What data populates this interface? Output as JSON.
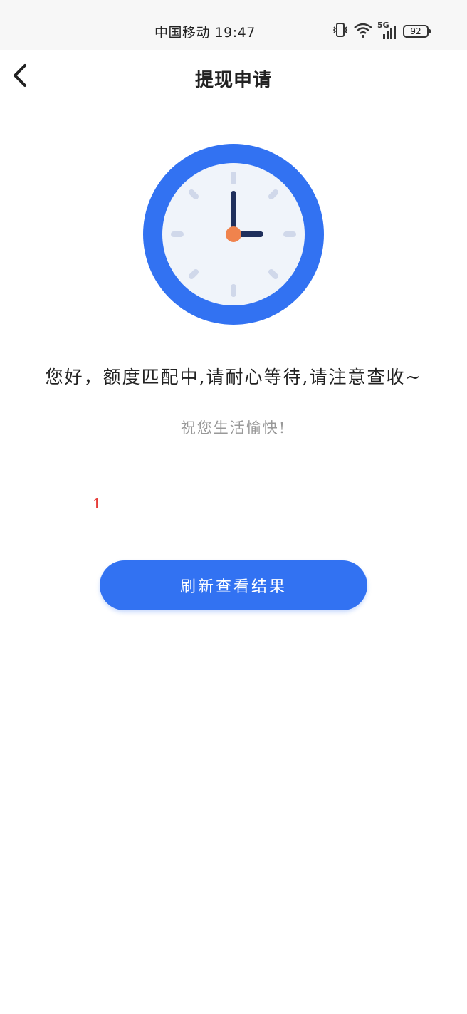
{
  "status_bar": {
    "carrier_time": "中国移动 19:47",
    "network_label": "5G",
    "battery": "92",
    "icons": [
      "vibrate-icon",
      "wifi-icon",
      "signal-icon",
      "battery-icon"
    ]
  },
  "header": {
    "title": "提现申请",
    "back_icon": "chevron-left-icon"
  },
  "main": {
    "illustration": "clock-icon",
    "message": "您好，额度匹配中,请耐心等待,请注意查收~",
    "wish": "祝您生活愉快!",
    "counter": "1",
    "refresh_label": "刷新查看结果"
  },
  "colors": {
    "accent": "#3272f2",
    "clock_face": "#f0f4fa",
    "clock_hand": "#1f2f5c",
    "clock_center": "#f0834d",
    "counter": "#e53935"
  }
}
